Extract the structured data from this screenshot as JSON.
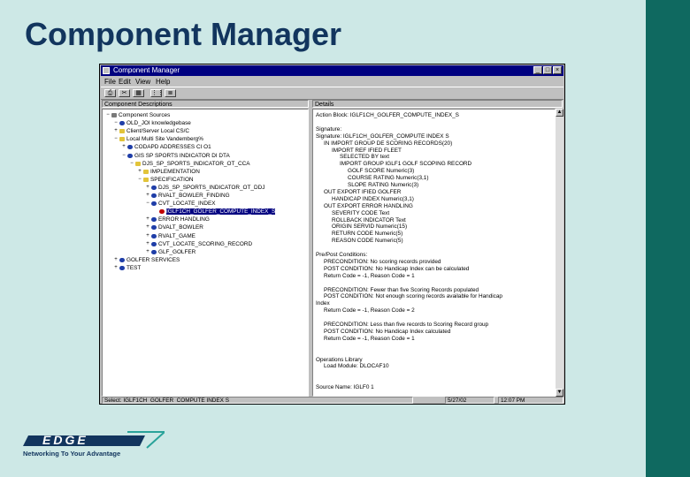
{
  "slide": {
    "title": "Component Manager",
    "logo_text": "EDGE",
    "logo_tagline": "Networking To Your Advantage",
    "colors": {
      "background": "#cde8e6",
      "stripe": "#0f6960",
      "title": "#12355e",
      "window_titlebar": "#000080"
    }
  },
  "window": {
    "title": "Component Manager",
    "min_glyph": "_",
    "max_glyph": "□",
    "close_glyph": "×",
    "menu": [
      "File",
      "Edit",
      "View",
      "Help"
    ],
    "toolbar_icons": [
      "print-icon",
      "cut-icon",
      "paste-icon",
      "tree-view-icon",
      "list-view-icon"
    ],
    "toolbar_glyphs": [
      "⎙",
      "✂",
      "▦",
      "⋮⋮",
      "≣"
    ],
    "left_pane_label": "Component Descriptions",
    "right_pane_label": "Details"
  },
  "tree": [
    {
      "label": "Component Sources",
      "indent": 0,
      "toggle": "−",
      "icon": "pc"
    },
    {
      "label": "OLD_JOI knowledgebase",
      "indent": 1,
      "toggle": "−",
      "icon": "db"
    },
    {
      "label": "Client/Server Local CS/C",
      "indent": 1,
      "toggle": "+",
      "icon": "folder"
    },
    {
      "label": "Local Multi Site Vandemberg%",
      "indent": 1,
      "toggle": "−",
      "icon": "folder"
    },
    {
      "label": "CODAPD ADDRESSES CI O1",
      "indent": 2,
      "toggle": "+",
      "icon": "db"
    },
    {
      "label": "GIS SP SPORTS INDICATOR DI DTA",
      "indent": 2,
      "toggle": "−",
      "icon": "db"
    },
    {
      "label": "DJS_SP_SPORTS_INDICATOR_OT_CCA",
      "indent": 3,
      "toggle": "−",
      "icon": "folder"
    },
    {
      "label": "IMPLEMENTATION",
      "indent": 4,
      "toggle": "+",
      "icon": "folder"
    },
    {
      "label": "SPECIFICATION",
      "indent": 4,
      "toggle": "−",
      "icon": "folder"
    },
    {
      "label": "DJS_SP_SPORTS_INDICATOR_OT_DDJ",
      "indent": 5,
      "toggle": "+",
      "icon": "db"
    },
    {
      "label": "RVALT_BOWLER_FINDING",
      "indent": 5,
      "toggle": "+",
      "icon": "db"
    },
    {
      "label": "CVT_LOCATE_INDEX",
      "indent": 5,
      "toggle": "−",
      "icon": "db"
    },
    {
      "label": "IGLF1CH_GOLFER_COMPUTE_INDEX_S",
      "indent": 6,
      "toggle": "",
      "icon": "red",
      "selected": true
    },
    {
      "label": "ERROR HANDLING",
      "indent": 5,
      "toggle": "+",
      "icon": "db"
    },
    {
      "label": "DVALT_BOWLER",
      "indent": 5,
      "toggle": "+",
      "icon": "db"
    },
    {
      "label": "RVALT_GAME",
      "indent": 5,
      "toggle": "+",
      "icon": "db"
    },
    {
      "label": "CVT_LOCATE_SCORING_RECORD",
      "indent": 5,
      "toggle": "+",
      "icon": "db"
    },
    {
      "label": "GLF_GOLFER",
      "indent": 5,
      "toggle": "+",
      "icon": "db"
    },
    {
      "label": "GOLFER SERVICES",
      "indent": 1,
      "toggle": "+",
      "icon": "db"
    },
    {
      "label": "TEST",
      "indent": 1,
      "toggle": "+",
      "icon": "db"
    }
  ],
  "details": [
    {
      "text": "Action Block:   IGLF1CH_GOLFER_COMPUTE_INDEX_S",
      "indent": 0
    },
    {
      "text": "",
      "indent": 0
    },
    {
      "text": "Signature:",
      "indent": 0
    },
    {
      "text": "Signature: IGLF1CH_GOLFER_COMPUTE INDEX S",
      "indent": 0
    },
    {
      "text": "IN IMPORT GROUP DE SCORING RECORDS(20)",
      "indent": 1
    },
    {
      "text": "IMPORT REF IFIED FLEET",
      "indent": 2
    },
    {
      "text": "SELECTED BY text",
      "indent": 3
    },
    {
      "text": "IMPORT GROUP IGLF1 GOLF SCOPING RECORD",
      "indent": 3
    },
    {
      "text": "GOLF SCORE Numeric(3)",
      "indent": 4
    },
    {
      "text": "COURSE RATING Numeric(3,1)",
      "indent": 4
    },
    {
      "text": "SLOPE RATING Numeric(3)",
      "indent": 4
    },
    {
      "text": "OUT EXPORT IFIED GOLFER",
      "indent": 1
    },
    {
      "text": "HANDICAP INDEX Numeric(3,1)",
      "indent": 2
    },
    {
      "text": "OUT EXPORT ERROR HANDLING",
      "indent": 1
    },
    {
      "text": "SEVERITY CODE Text",
      "indent": 2
    },
    {
      "text": "ROLLBACK INDICATOR Text",
      "indent": 2
    },
    {
      "text": "ORIGIN SERVID Numeric(15)",
      "indent": 2
    },
    {
      "text": "RETURN CODE Numeric(5)",
      "indent": 2
    },
    {
      "text": "REASON CODE Numeric(5)",
      "indent": 2
    },
    {
      "text": "",
      "indent": 0
    },
    {
      "text": "Pre/Post Conditions:",
      "indent": 0
    },
    {
      "text": "PRECONDITION: No scoring records provided",
      "indent": 1
    },
    {
      "text": "POST CONDITION: No Handicap Index can be calculated",
      "indent": 1
    },
    {
      "text": "Return Code = -1, Reason Code = 1",
      "indent": 1
    },
    {
      "text": "",
      "indent": 0
    },
    {
      "text": "PRECONDITION: Fewer than five Scoring Records populated",
      "indent": 1
    },
    {
      "text": "POST CONDITION: Not enough scoring records available for Handicap",
      "indent": 1
    },
    {
      "text": "Index",
      "indent": 0
    },
    {
      "text": "Return Code = -1, Reason Code = 2",
      "indent": 1
    },
    {
      "text": "",
      "indent": 0
    },
    {
      "text": "PRECONDITION: Less than five records to Scoring Record group",
      "indent": 1
    },
    {
      "text": "POST CONDITION: No Handicap Index calculated",
      "indent": 1
    },
    {
      "text": "Return Code = -1, Reason Code = 1",
      "indent": 1
    },
    {
      "text": "",
      "indent": 0
    },
    {
      "text": "",
      "indent": 0
    },
    {
      "text": "Operations Library",
      "indent": 0
    },
    {
      "text": "Load Module: DLOCAF10",
      "indent": 1
    },
    {
      "text": "",
      "indent": 0
    },
    {
      "text": "",
      "indent": 0
    },
    {
      "text": "Source Name: IGLF0 1",
      "indent": 0
    }
  ],
  "scrollbar": {
    "up": "▲",
    "down": "▼"
  },
  "status": {
    "selection": "Select: IGLF1CH_GOLFER_COMPUTE INDEX S",
    "date": "5/27/02",
    "time": "12:07 PM"
  }
}
